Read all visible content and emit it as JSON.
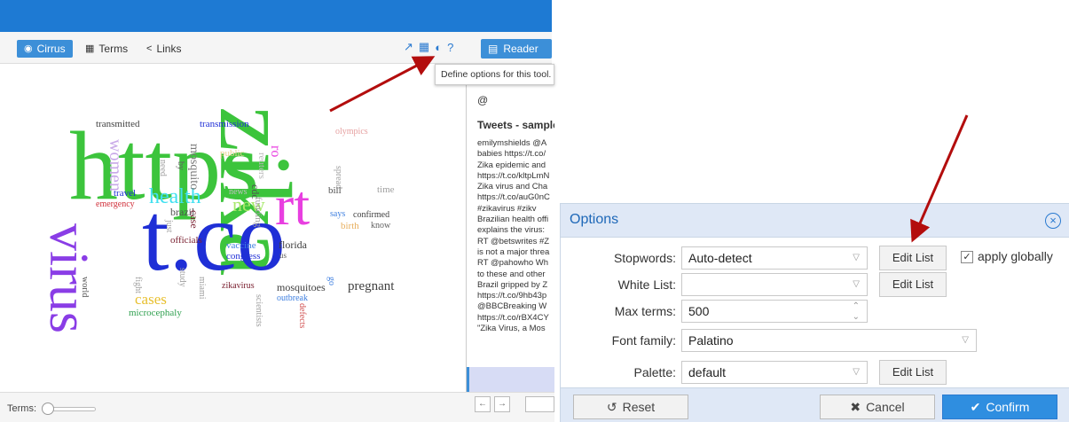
{
  "toolbar": {
    "tabs": [
      {
        "label": "Cirrus",
        "icon": "eye-icon"
      },
      {
        "label": "Terms",
        "icon": "table-icon"
      },
      {
        "label": "Links",
        "icon": "share-icon"
      }
    ],
    "help_symbol": "?",
    "reader_label": "Reader"
  },
  "tooltip": "Define options for this tool.",
  "wordcloud": {
    "words": [
      {
        "text": "https",
        "color": "#3cc43c"
      },
      {
        "text": "zika",
        "color": "#3cc43c"
      },
      {
        "text": "t.co",
        "color": "#1f2fd6"
      },
      {
        "text": "virus",
        "color": "#8a3de6"
      },
      {
        "text": "rt",
        "color": "#e83fe0"
      },
      {
        "text": "health",
        "color": "#3fe0f0"
      },
      {
        "text": "new",
        "color": "#a8e86c"
      },
      {
        "text": "women",
        "color": "#c8a8e8"
      },
      {
        "text": "mosquito",
        "color": "#7a7a7a"
      },
      {
        "text": "transmitted",
        "color": "#3f3f3f"
      },
      {
        "text": "transmission",
        "color": "#1f2fd6"
      },
      {
        "text": "olympics",
        "color": "#e6a0a0"
      },
      {
        "text": "public",
        "color": "#e8d090"
      },
      {
        "text": "reuters",
        "color": "#b8b8b8"
      },
      {
        "text": "need",
        "color": "#a0a0a0"
      },
      {
        "text": "by",
        "color": "#606060"
      },
      {
        "text": "travel",
        "color": "#1f2fd6"
      },
      {
        "text": "emergency",
        "color": "#d0303a"
      },
      {
        "text": "brazil",
        "color": "#505050"
      },
      {
        "text": "just",
        "color": "#a0a0a0"
      },
      {
        "text": "officials",
        "color": "#7a2030"
      },
      {
        "text": "case",
        "color": "#7a2030"
      },
      {
        "text": "news",
        "color": "#c0c0c0"
      },
      {
        "text": "cdc",
        "color": "#505050"
      },
      {
        "text": "funding",
        "color": "#a0a0a0"
      },
      {
        "text": "vaccine",
        "color": "#4080e0"
      },
      {
        "text": "congress",
        "color": "#1f2fd6"
      },
      {
        "text": "florida",
        "color": "#3f3f3f"
      },
      {
        "text": "bill",
        "color": "#505050"
      },
      {
        "text": "time",
        "color": "#a0a0a0"
      },
      {
        "text": "spread",
        "color": "#a0a0a0"
      },
      {
        "text": "says",
        "color": "#4080e0"
      },
      {
        "text": "confirmed",
        "color": "#3f3f3f"
      },
      {
        "text": "birth",
        "color": "#e8b060"
      },
      {
        "text": "know",
        "color": "#606060"
      },
      {
        "text": "study",
        "color": "#a0a0a0"
      },
      {
        "text": "cases",
        "color": "#e8c030"
      },
      {
        "text": "microcephaly",
        "color": "#30a050"
      },
      {
        "text": "world",
        "color": "#505050"
      },
      {
        "text": "fight",
        "color": "#a0a0a0"
      },
      {
        "text": "miami",
        "color": "#a0a0a0"
      },
      {
        "text": "zikavirus",
        "color": "#7a2030"
      },
      {
        "text": "mosquitoes",
        "color": "#3f3f3f"
      },
      {
        "text": "scientists",
        "color": "#a0a0a0"
      },
      {
        "text": "outbreak",
        "color": "#4080e0"
      },
      {
        "text": "defects",
        "color": "#d05050"
      },
      {
        "text": "pregnant",
        "color": "#3f3f3f"
      },
      {
        "text": "us",
        "color": "#606060"
      },
      {
        "text": "go",
        "color": "#4080e0"
      },
      {
        "text": "ro",
        "color": "#e83fe0"
      }
    ]
  },
  "reader": {
    "at_symbol": "@",
    "title": "Tweets - sample",
    "lines": [
      "emilymshields @A",
      "babies https://t.co/",
      "Zika epidemic and",
      "https://t.co/kltpLmN",
      "Zika virus and Cha",
      "https://t.co/auG0nC",
      "#zikavirus #zikv",
      "Brazilian health offi",
      "explains the virus:",
      "RT @betswrites #Z",
      "is not a major threa",
      "RT @pahowho Wh",
      "to these and other",
      "Brazil gripped by Z",
      "https://t.co/9hb43p",
      "@BBCBreaking W",
      "https://t.co/rBX4CY",
      "\"Zika Virus, a Mos"
    ]
  },
  "footer_left": {
    "terms_label": "Terms:",
    "terms_slider_level": 0.05,
    "prev_symbol": "←",
    "next_symbol": "→"
  },
  "options": {
    "title": "Options",
    "rows": {
      "stopwords": {
        "label": "Stopwords:",
        "value": "Auto-detect",
        "button": "Edit List"
      },
      "whitelist": {
        "label": "White List:",
        "value": "",
        "button": "Edit List"
      },
      "maxterms": {
        "label": "Max terms:",
        "value": "500"
      },
      "fontfamily": {
        "label": "Font family:",
        "value": "Palatino"
      },
      "palette": {
        "label": "Palette:",
        "value": "default",
        "button": "Edit List"
      }
    },
    "apply_globally_label": "apply globally",
    "apply_globally_checked": true,
    "reset_label": "Reset",
    "cancel_label": "Cancel",
    "confirm_label": "Confirm"
  },
  "colors": {
    "brand_blue": "#1e7ad3",
    "annotation_arrow": "#b30d0d",
    "dialog_header": "#dfe8f6"
  }
}
